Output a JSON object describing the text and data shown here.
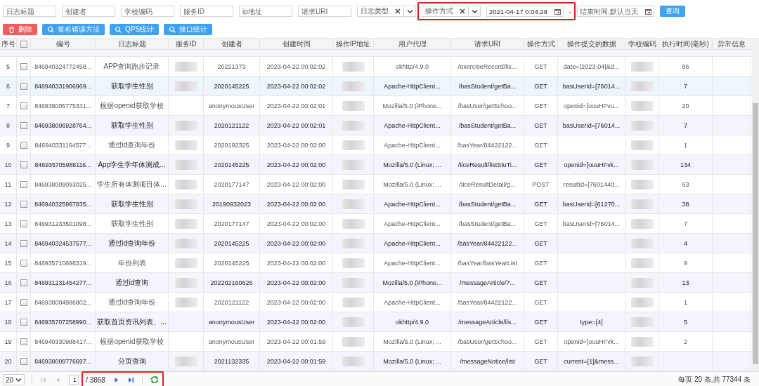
{
  "filters": [
    {
      "kind": "input",
      "placeholder": "日志标题",
      "marked": false
    },
    {
      "kind": "input",
      "placeholder": "创建者",
      "marked": false
    },
    {
      "kind": "input",
      "placeholder": "学校编码",
      "marked": false
    },
    {
      "kind": "input",
      "placeholder": "服务ID",
      "marked": false
    },
    {
      "kind": "input",
      "placeholder": "ip地址",
      "marked": false
    },
    {
      "kind": "input",
      "placeholder": "请求URI",
      "marked": false
    },
    {
      "kind": "select",
      "placeholder": "日志类型",
      "marked": false
    },
    {
      "kind": "select",
      "placeholder": "操作方式",
      "marked": true
    },
    {
      "kind": "date",
      "value": "2021-04-17 0:04:28",
      "marked": true
    },
    {
      "kind": "separator",
      "text": "-",
      "marked": true
    },
    {
      "kind": "date",
      "placeholder": "结束时间,默认当天",
      "marked": false
    },
    {
      "kind": "button",
      "label": "查询",
      "marked": false
    }
  ],
  "actions": [
    {
      "kind": "danger",
      "label": "删除"
    },
    {
      "kind": "primary",
      "label": "签名错误方法"
    },
    {
      "kind": "primary",
      "label": "QPS统计"
    },
    {
      "kind": "primary",
      "label": "接口统计"
    }
  ],
  "table": {
    "select_all": {
      "checked": false
    },
    "columns": [
      "序号",
      "编号",
      "日志标题",
      "服务ID",
      "创建者",
      "创建时间",
      "操作IP地址",
      "用户代理",
      "请求URI",
      "操作方式",
      "操作提交的数据",
      "学校编码",
      "执行时间(毫秒)",
      "异常信息"
    ],
    "rows": [
      {
        "index": "5",
        "checked": false,
        "highlighted": false,
        "id": "846940324772458...",
        "title": "APP查询跑步记录",
        "service_id_blurred": true,
        "creator": "20221373",
        "created": "2023-04-22 00:02:02",
        "ip_blurred": true,
        "user_agent": "okhttp/4.9.0",
        "uri": "/exerciseRecord/lis...",
        "method": "GET",
        "data": "date=[2023-04]&d...",
        "school_blurred": true,
        "duration": "86"
      },
      {
        "index": "6",
        "checked": false,
        "highlighted": true,
        "id": "846940331906969...",
        "title": "获取学生性别",
        "service_id_blurred": true,
        "creator": "2020145225",
        "created": "2023-04-22 00:02:02",
        "ip_blurred": true,
        "user_agent": "Apache-HttpClient...",
        "uri": "/basStudent/getBa...",
        "method": "GET",
        "data": "basUserId=[76014...",
        "school_blurred": true,
        "duration": "7"
      },
      {
        "index": "7",
        "checked": false,
        "highlighted": false,
        "id": "846938005775331...",
        "title": "根据openid获取学校",
        "service_id_blurred": false,
        "creator": "anonymousUser",
        "created": "2023-04-22 00:02:01",
        "ip_blurred": true,
        "user_agent": "Mozilla/5.0 (iPhone...",
        "uri": "/basUser/getSchoo...",
        "method": "GET",
        "data": "openid=[ouuHFvu...",
        "school_blurred": true,
        "duration": "20"
      },
      {
        "index": "8",
        "checked": false,
        "highlighted": false,
        "id": "846938006928764...",
        "title": "获取学生性别",
        "service_id_blurred": true,
        "creator": "2020121122",
        "created": "2023-04-22 00:02:01",
        "ip_blurred": true,
        "user_agent": "Apache-HttpClient...",
        "uri": "/basStudent/getBa...",
        "method": "GET",
        "data": "basUserId=[76014...",
        "school_blurred": true,
        "duration": "7"
      },
      {
        "index": "9",
        "checked": false,
        "highlighted": false,
        "id": "846940331164577...",
        "title": "通过id查询年份",
        "service_id_blurred": true,
        "creator": "2020192325",
        "created": "2023-04-22 00:02:00",
        "ip_blurred": true,
        "user_agent": "Apache-HttpClient...",
        "uri": "/basYear/84422122...",
        "method": "GET",
        "school_blurred": true,
        "duration": "1"
      },
      {
        "index": "10",
        "checked": false,
        "highlighted": false,
        "id": "846935705988116...",
        "title": "App学生学年体测成...",
        "service_id_blurred": true,
        "creator": "2020145225",
        "created": "2023-04-22 00:02:00",
        "ip_blurred": true,
        "user_agent": "Mozilla/5.0 (Linux; ...",
        "uri": "/ticeResult/listStuTi...",
        "method": "GET",
        "data": "openid=[ouuHFvk...",
        "school_blurred": true,
        "duration": "134"
      },
      {
        "index": "11",
        "checked": false,
        "highlighted": false,
        "id": "846938009093025...",
        "title": "学生所有体测项目体...",
        "service_id_blurred": true,
        "creator": "2020177147",
        "created": "2023-04-22 00:02:00",
        "ip_blurred": true,
        "user_agent": "Mozilla/5.0 (Linux; ...",
        "uri": "/ticeResultDetail/g...",
        "method": "POST",
        "data": "resultId=[7601440...",
        "school_blurred": true,
        "duration": "63"
      },
      {
        "index": "12",
        "checked": false,
        "highlighted": false,
        "id": "846940325967835...",
        "title": "获取学生性别",
        "service_id_blurred": true,
        "creator": "20190932023",
        "created": "2023-04-22 00:02:00",
        "ip_blurred": true,
        "user_agent": "Apache-HttpClient...",
        "uri": "/basStudent/getBa...",
        "method": "GET",
        "data": "basUserId=[61270...",
        "school_blurred": true,
        "duration": "38"
      },
      {
        "index": "13",
        "checked": false,
        "highlighted": false,
        "id": "846931233501098...",
        "title": "获取学生性别",
        "service_id_blurred": true,
        "creator": "2020177147",
        "created": "2023-04-22 00:02:00",
        "ip_blurred": true,
        "user_agent": "Apache-HttpClient...",
        "uri": "/basStudent/getBa...",
        "method": "GET",
        "data": "basUserId=[76014...",
        "school_blurred": true,
        "duration": "7"
      },
      {
        "index": "14",
        "checked": false,
        "highlighted": false,
        "id": "846940324537577...",
        "title": "通过id查询年份",
        "service_id_blurred": true,
        "creator": "2020145225",
        "created": "2023-04-22 00:02:00",
        "ip_blurred": true,
        "user_agent": "Apache-HttpClient...",
        "uri": "/basYear/84422122...",
        "method": "GET",
        "school_blurred": true,
        "duration": "4"
      },
      {
        "index": "15",
        "checked": false,
        "highlighted": false,
        "id": "846935710698319...",
        "title": "年份列表",
        "service_id_blurred": true,
        "creator": "2020145225",
        "created": "2023-04-22 00:02:00",
        "ip_blurred": true,
        "user_agent": "Apache-HttpClient...",
        "uri": "/basYear/basYearList",
        "method": "GET",
        "school_blurred": true,
        "duration": "9"
      },
      {
        "index": "16",
        "checked": false,
        "highlighted": false,
        "id": "846931231454277...",
        "title": "通过id查询",
        "service_id_blurred": true,
        "creator": "202202160626",
        "created": "2023-04-22 00:02:00",
        "ip_blurred": true,
        "user_agent": "Mozilla/5.0 (iPhone...",
        "uri": "/messageArticle/7...",
        "method": "GET",
        "school_blurred": true,
        "duration": "13"
      },
      {
        "index": "17",
        "checked": false,
        "highlighted": false,
        "id": "846938004986802...",
        "title": "通过id查询年份",
        "service_id_blurred": true,
        "creator": "2020121122",
        "created": "2023-04-22 00:02:00",
        "ip_blurred": true,
        "user_agent": "Apache-HttpClient...",
        "uri": "/basYear/84422122...",
        "method": "GET",
        "school_blurred": true,
        "duration": "1"
      },
      {
        "index": "18",
        "checked": false,
        "highlighted": false,
        "id": "846935707258990...",
        "title": "获取首页资讯列表、...",
        "service_id_blurred": false,
        "creator": "anonymousUser",
        "created": "2023-04-22 00:02:00",
        "ip_blurred": true,
        "user_agent": "okhttp/4.9.0",
        "uri": "/messageArticle/lis...",
        "method": "GET",
        "data": "type=[4]",
        "school_blurred": true,
        "duration": "5"
      },
      {
        "index": "19",
        "checked": false,
        "highlighted": false,
        "id": "846940330988417...",
        "title": "根据openid获取学校",
        "service_id_blurred": false,
        "creator": "anonymousUser",
        "created": "2023-04-22 00:01:59",
        "ip_blurred": true,
        "user_agent": "Mozilla/5.0 (Linux; ...",
        "uri": "/basUser/getSchoo...",
        "method": "GET",
        "data": "openid=[ouuHFvk...",
        "school_blurred": true,
        "duration": "2"
      },
      {
        "index": "20",
        "checked": false,
        "highlighted": false,
        "id": "846938009776697...",
        "title": "分页查询",
        "service_id_blurred": true,
        "creator": "2021132335",
        "created": "2023-04-22 00:01:59",
        "ip_blurred": true,
        "user_agent": "Mozilla/5.0 (Linux; ...",
        "uri": "/messageNotice/list",
        "method": "GET",
        "data": "current=[1]&mess...",
        "school_blurred": true
      }
    ]
  },
  "pager": {
    "page_size": "20",
    "page": "1",
    "total_pages": "/ 3868",
    "marked": true,
    "nav": [
      {
        "kind": "first",
        "disabled": true
      },
      {
        "kind": "prev",
        "disabled": true
      },
      {
        "kind": "next",
        "disabled": false
      },
      {
        "kind": "last",
        "disabled": false
      }
    ],
    "summary": "每页 20 条,共 77344 条"
  }
}
